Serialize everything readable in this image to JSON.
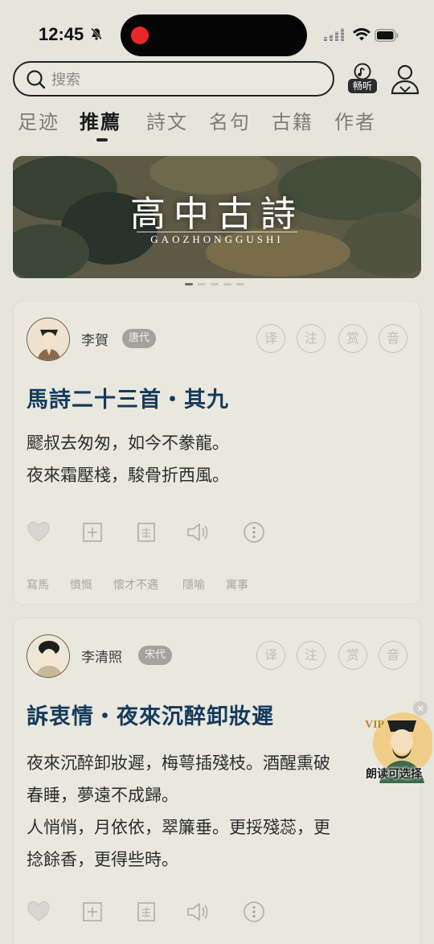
{
  "status_bar": {
    "time": "12:45"
  },
  "search": {
    "placeholder": "搜索",
    "value": ""
  },
  "listen": {
    "label": "畅听"
  },
  "tabs": [
    {
      "label": "足迹",
      "active": false
    },
    {
      "label": "推薦",
      "active": true
    },
    {
      "label": "詩文",
      "active": false
    },
    {
      "label": "名句",
      "active": false
    },
    {
      "label": "古籍",
      "active": false
    },
    {
      "label": "作者",
      "active": false
    }
  ],
  "banner": {
    "title": "高中古詩",
    "subtitle": "GAOZHONGGUSHI",
    "slide_count": 5,
    "active_slide": 0
  },
  "cards": [
    {
      "author": "李賀",
      "dynasty": "唐代",
      "buttons": [
        "译",
        "注",
        "赏",
        "音"
      ],
      "title": "馬詩二十三首・其九",
      "body": "飂叔去匆匆，如今不豢龍。\n夜來霜壓棧，駿骨折西風。",
      "tags": [
        "寫馬",
        "憤慨",
        "懷才不遇",
        "隱喻",
        "寓事"
      ]
    },
    {
      "author": "李清照",
      "dynasty": "宋代",
      "buttons": [
        "译",
        "注",
        "赏",
        "音"
      ],
      "title": "訴衷情・夜來沉醉卸妝遲",
      "body": "夜來沉醉卸妝遲，梅萼插殘枝。酒醒熏破\n春睡，夢遠不成歸。\n人悄悄，月依依，翠簾垂。更挼殘蕊，更\n捻餘香，更得些時。",
      "tags": []
    }
  ],
  "vip_badge": {
    "label": "VIP",
    "caption": "朗读可选择"
  },
  "colors": {
    "background": "#e6e5dc",
    "title_blue": "#153a5c",
    "dynasty_tag": "#a3a29c"
  }
}
